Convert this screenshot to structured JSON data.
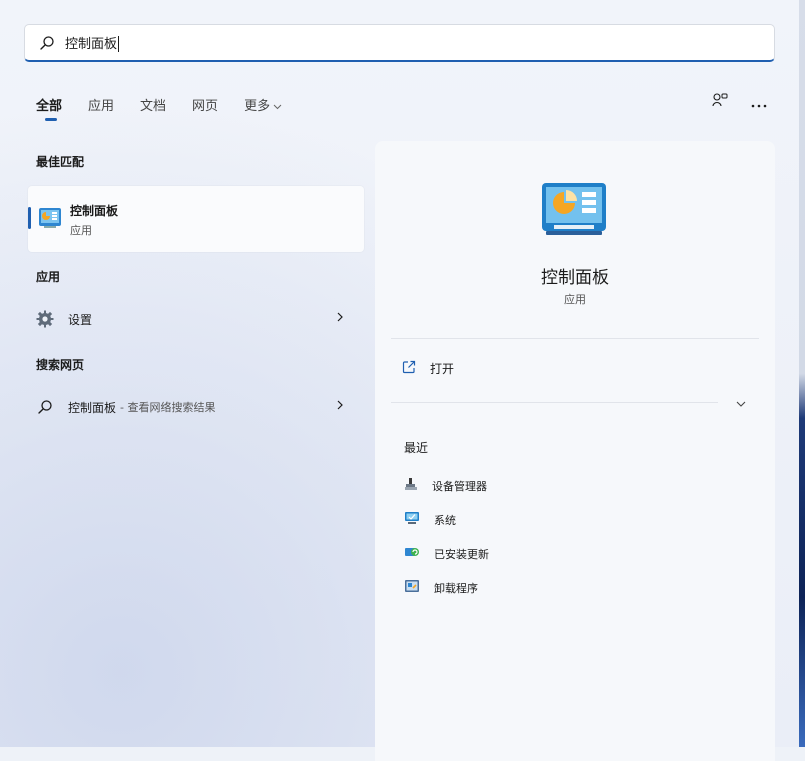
{
  "search": {
    "value": "控制面板"
  },
  "tabs": [
    {
      "label": "全部",
      "active": true
    },
    {
      "label": "应用"
    },
    {
      "label": "文档"
    },
    {
      "label": "网页"
    },
    {
      "label": "更多"
    }
  ],
  "sections": {
    "best_match": "最佳匹配",
    "apps": "应用",
    "web": "搜索网页"
  },
  "best_match": {
    "title": "控制面板",
    "subtitle": "应用"
  },
  "apps": [
    {
      "label": "设置"
    }
  ],
  "web": {
    "label": "控制面板",
    "suffix": "- 查看网络搜索结果"
  },
  "detail": {
    "title": "控制面板",
    "subtitle": "应用",
    "open_label": "打开",
    "recent_heading": "最近",
    "recent": [
      {
        "label": "设备管理器",
        "icon": "device-manager-icon"
      },
      {
        "label": "系统",
        "icon": "system-icon"
      },
      {
        "label": "已安装更新",
        "icon": "installed-updates-icon"
      },
      {
        "label": "卸载程序",
        "icon": "uninstall-icon"
      }
    ]
  },
  "colors": {
    "accent": "#1f5fb0",
    "panel_bg": "#f6f8fb"
  }
}
